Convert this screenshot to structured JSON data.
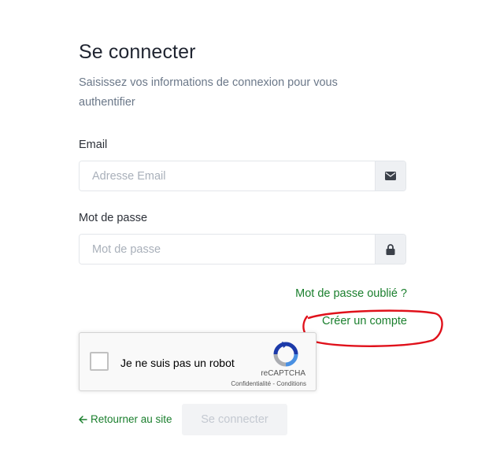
{
  "header": {
    "title": "Se connecter",
    "subtitle": "Saisissez vos informations de connexion pour vous authentifier"
  },
  "form": {
    "email_label": "Email",
    "email_placeholder": "Adresse Email",
    "email_value": "",
    "email_icon": "envelope-icon",
    "password_label": "Mot de passe",
    "password_placeholder": "Mot de passe",
    "password_value": "",
    "password_icon": "lock-icon"
  },
  "links": {
    "forgot_password": "Mot de passe oublié ?",
    "create_account": "Créer un compte"
  },
  "recaptcha": {
    "label": "Je ne suis pas un robot",
    "brand": "reCAPTCHA",
    "terms": "Confidentialité - Conditions",
    "checked": false
  },
  "footer": {
    "back_link": "Retourner au site",
    "submit_label": "Se connecter"
  },
  "colors": {
    "accent": "#1a7f2d",
    "annotation": "#e0111b",
    "title": "#1f2430",
    "muted": "#6b7889"
  }
}
